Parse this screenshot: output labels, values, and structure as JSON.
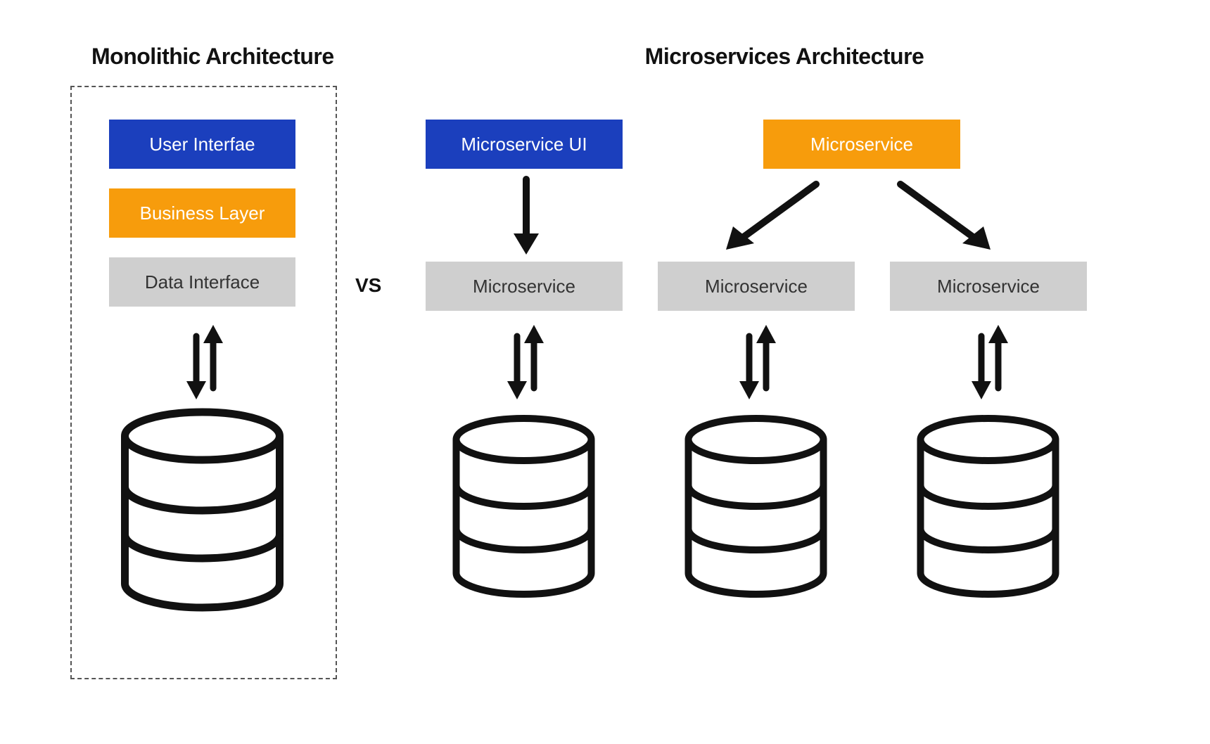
{
  "titles": {
    "monolith": "Monolithic Architecture",
    "microservices": "Microservices Architecture"
  },
  "vs_label": "VS",
  "monolith": {
    "ui": "User Interfae",
    "business": "Business Layer",
    "data": "Data Interface"
  },
  "microservices": {
    "ui_block": "Microservice UI",
    "top_service": "Microservice",
    "service1": "Microservice",
    "service2": "Microservice",
    "service3": "Microservice"
  },
  "colors": {
    "blue": "#1b3fbd",
    "orange": "#f79c0c",
    "grey": "#cfcfcf"
  }
}
